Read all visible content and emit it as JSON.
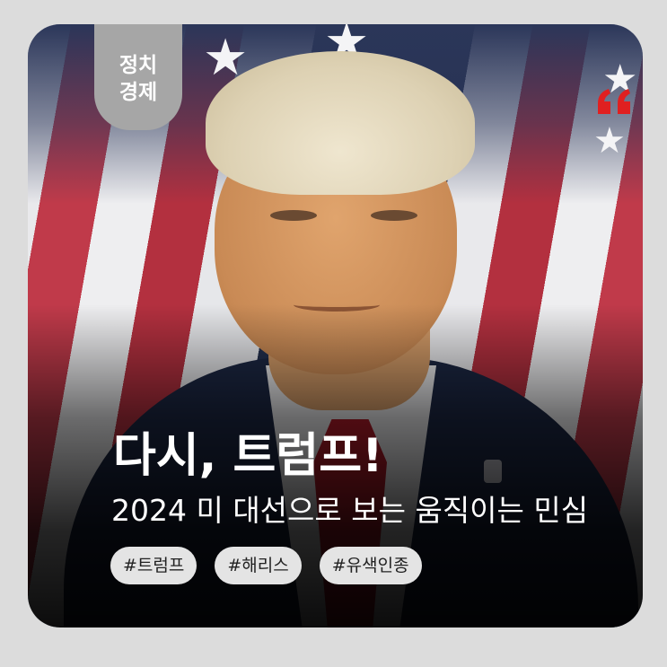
{
  "card": {
    "category_line1": "정치",
    "category_line2": "경제",
    "title": "다시, 트럼프!",
    "subtitle": "2024 미 대선으로 보는 움직이는 민심",
    "tags": [
      "#트럼프",
      "#해리스",
      "#유색인종"
    ]
  },
  "icons": {
    "brand": "quote-icon"
  },
  "colors": {
    "page_background": "#dcdcdc",
    "category_tab": "#a6a6a6",
    "tag_background": "#e4e4e4",
    "brand_red": "#e02020",
    "text": "#ffffff"
  }
}
